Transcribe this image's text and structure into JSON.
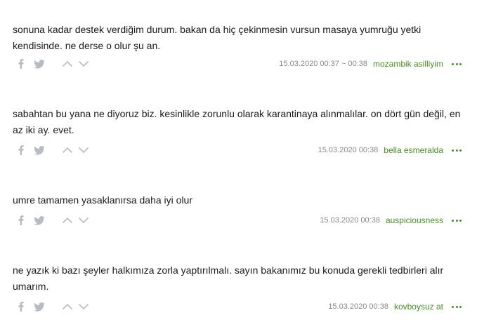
{
  "colors": {
    "text": "#1a1a1a",
    "date": "#888888",
    "author": "#4a8a2b",
    "icon": "#b7bcc2"
  },
  "icons": {
    "share_facebook": "facebook-icon",
    "share_twitter": "twitter-icon",
    "upvote": "chevron-up-icon",
    "downvote": "chevron-down-icon",
    "more": "more-dots-icon"
  },
  "entries": [
    {
      "text": "sonuna kadar destek verdiğim durum. bakan da hiç çekinmesin vursun masaya yumruğu yetki kendisinde. ne derse o olur şu an.",
      "date": "15.03.2020 00:37 ~ 00:38",
      "author": "mozambik asilliyim"
    },
    {
      "text": "sabahtan bu yana ne diyoruz biz. kesinlikle zorunlu olarak karantinaya alınmalılar. on dört gün değil, en az iki ay. evet.",
      "date": "15.03.2020 00:38",
      "author": "bella esmeralda"
    },
    {
      "text": "umre tamamen yasaklanırsa daha iyi olur",
      "date": "15.03.2020 00:38",
      "author": "auspiciousness"
    },
    {
      "text": "ne yazık ki bazı şeyler halkımıza zorla yaptırılmalı. sayın bakanımız bu konuda gerekli tedbirleri alır umarım.",
      "date": "15.03.2020 00:38",
      "author": "kovboysuz at"
    }
  ]
}
